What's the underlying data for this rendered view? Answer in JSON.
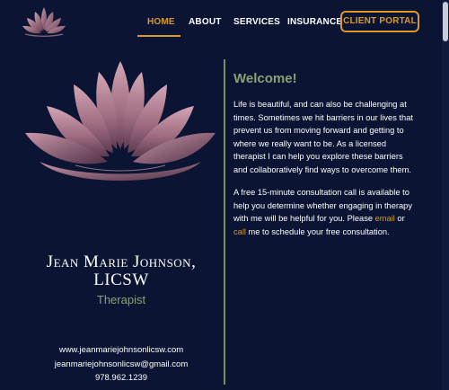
{
  "nav": {
    "items": [
      {
        "label": "HOME",
        "active": true
      },
      {
        "label": "ABOUT"
      },
      {
        "label": "SERVICES"
      },
      {
        "label": "INSURANCE"
      }
    ],
    "portal_label": "CLIENT PORTAL"
  },
  "profile": {
    "name_line1": "Jean Marie Johnson,",
    "name_line2": "LICSW",
    "role": "Therapist",
    "website": "www.jeanmariejohnsonlicsw.com",
    "email": "jeanmariejohnsonlicsw@gmail.com",
    "phone": "978.962.1239"
  },
  "welcome": {
    "title": "Welcome!",
    "para1_lines": [
      "Life is beautiful, and can also be challenging at",
      "times. Sometimes we hit barriers in our lives that",
      "prevent us from moving forward and getting to",
      "where we really want to be. As a licensed",
      "therapist I can help you explore these barriers",
      "and collaboratively find ways to overcome them."
    ],
    "para2": {
      "line1": "A free 15-minute consultation call is available to",
      "line2": "help you determine whether engaging in therapy",
      "line3_pre": "with me will be helpful for you. Please ",
      "email_link": "email",
      "line3_post": " or",
      "call_link": "call",
      "line4_post": " me to schedule your free consultation."
    }
  },
  "colors": {
    "background": "#0b1433",
    "accent": "#d99a2b",
    "olive": "#8fa070",
    "lotus": "#b07a8e"
  },
  "icons": {
    "logo": "lotus-logo-icon",
    "hero": "lotus-flower-icon"
  }
}
